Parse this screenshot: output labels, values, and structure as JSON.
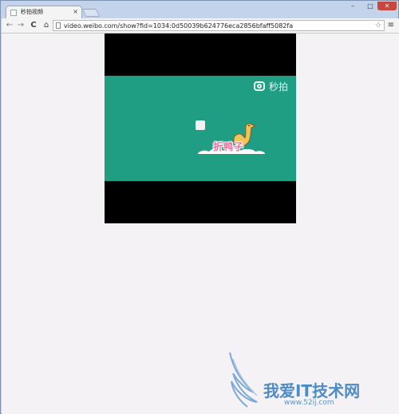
{
  "tab": {
    "title": "秒拍视频",
    "close": "×"
  },
  "window": {
    "minimize": "–",
    "maximize": "□",
    "close": "✕"
  },
  "toolbar": {
    "back": "←",
    "forward": "→",
    "reload": "C",
    "home": "⌂",
    "url": "video.weibo.com/show?fid=1034:0d50039b624776eca2856bfaff5082fa",
    "star": "☆",
    "menu": "≡"
  },
  "video": {
    "brand_label": "秒拍",
    "logo_text": "折鸭子"
  },
  "watermark": {
    "text": "我爱IT技术网",
    "sub": "www.52ij.com"
  },
  "colors": {
    "video_bg": "#1f9e83",
    "page_bg": "#f4f2f5",
    "watermark": "#4d8cc7"
  }
}
